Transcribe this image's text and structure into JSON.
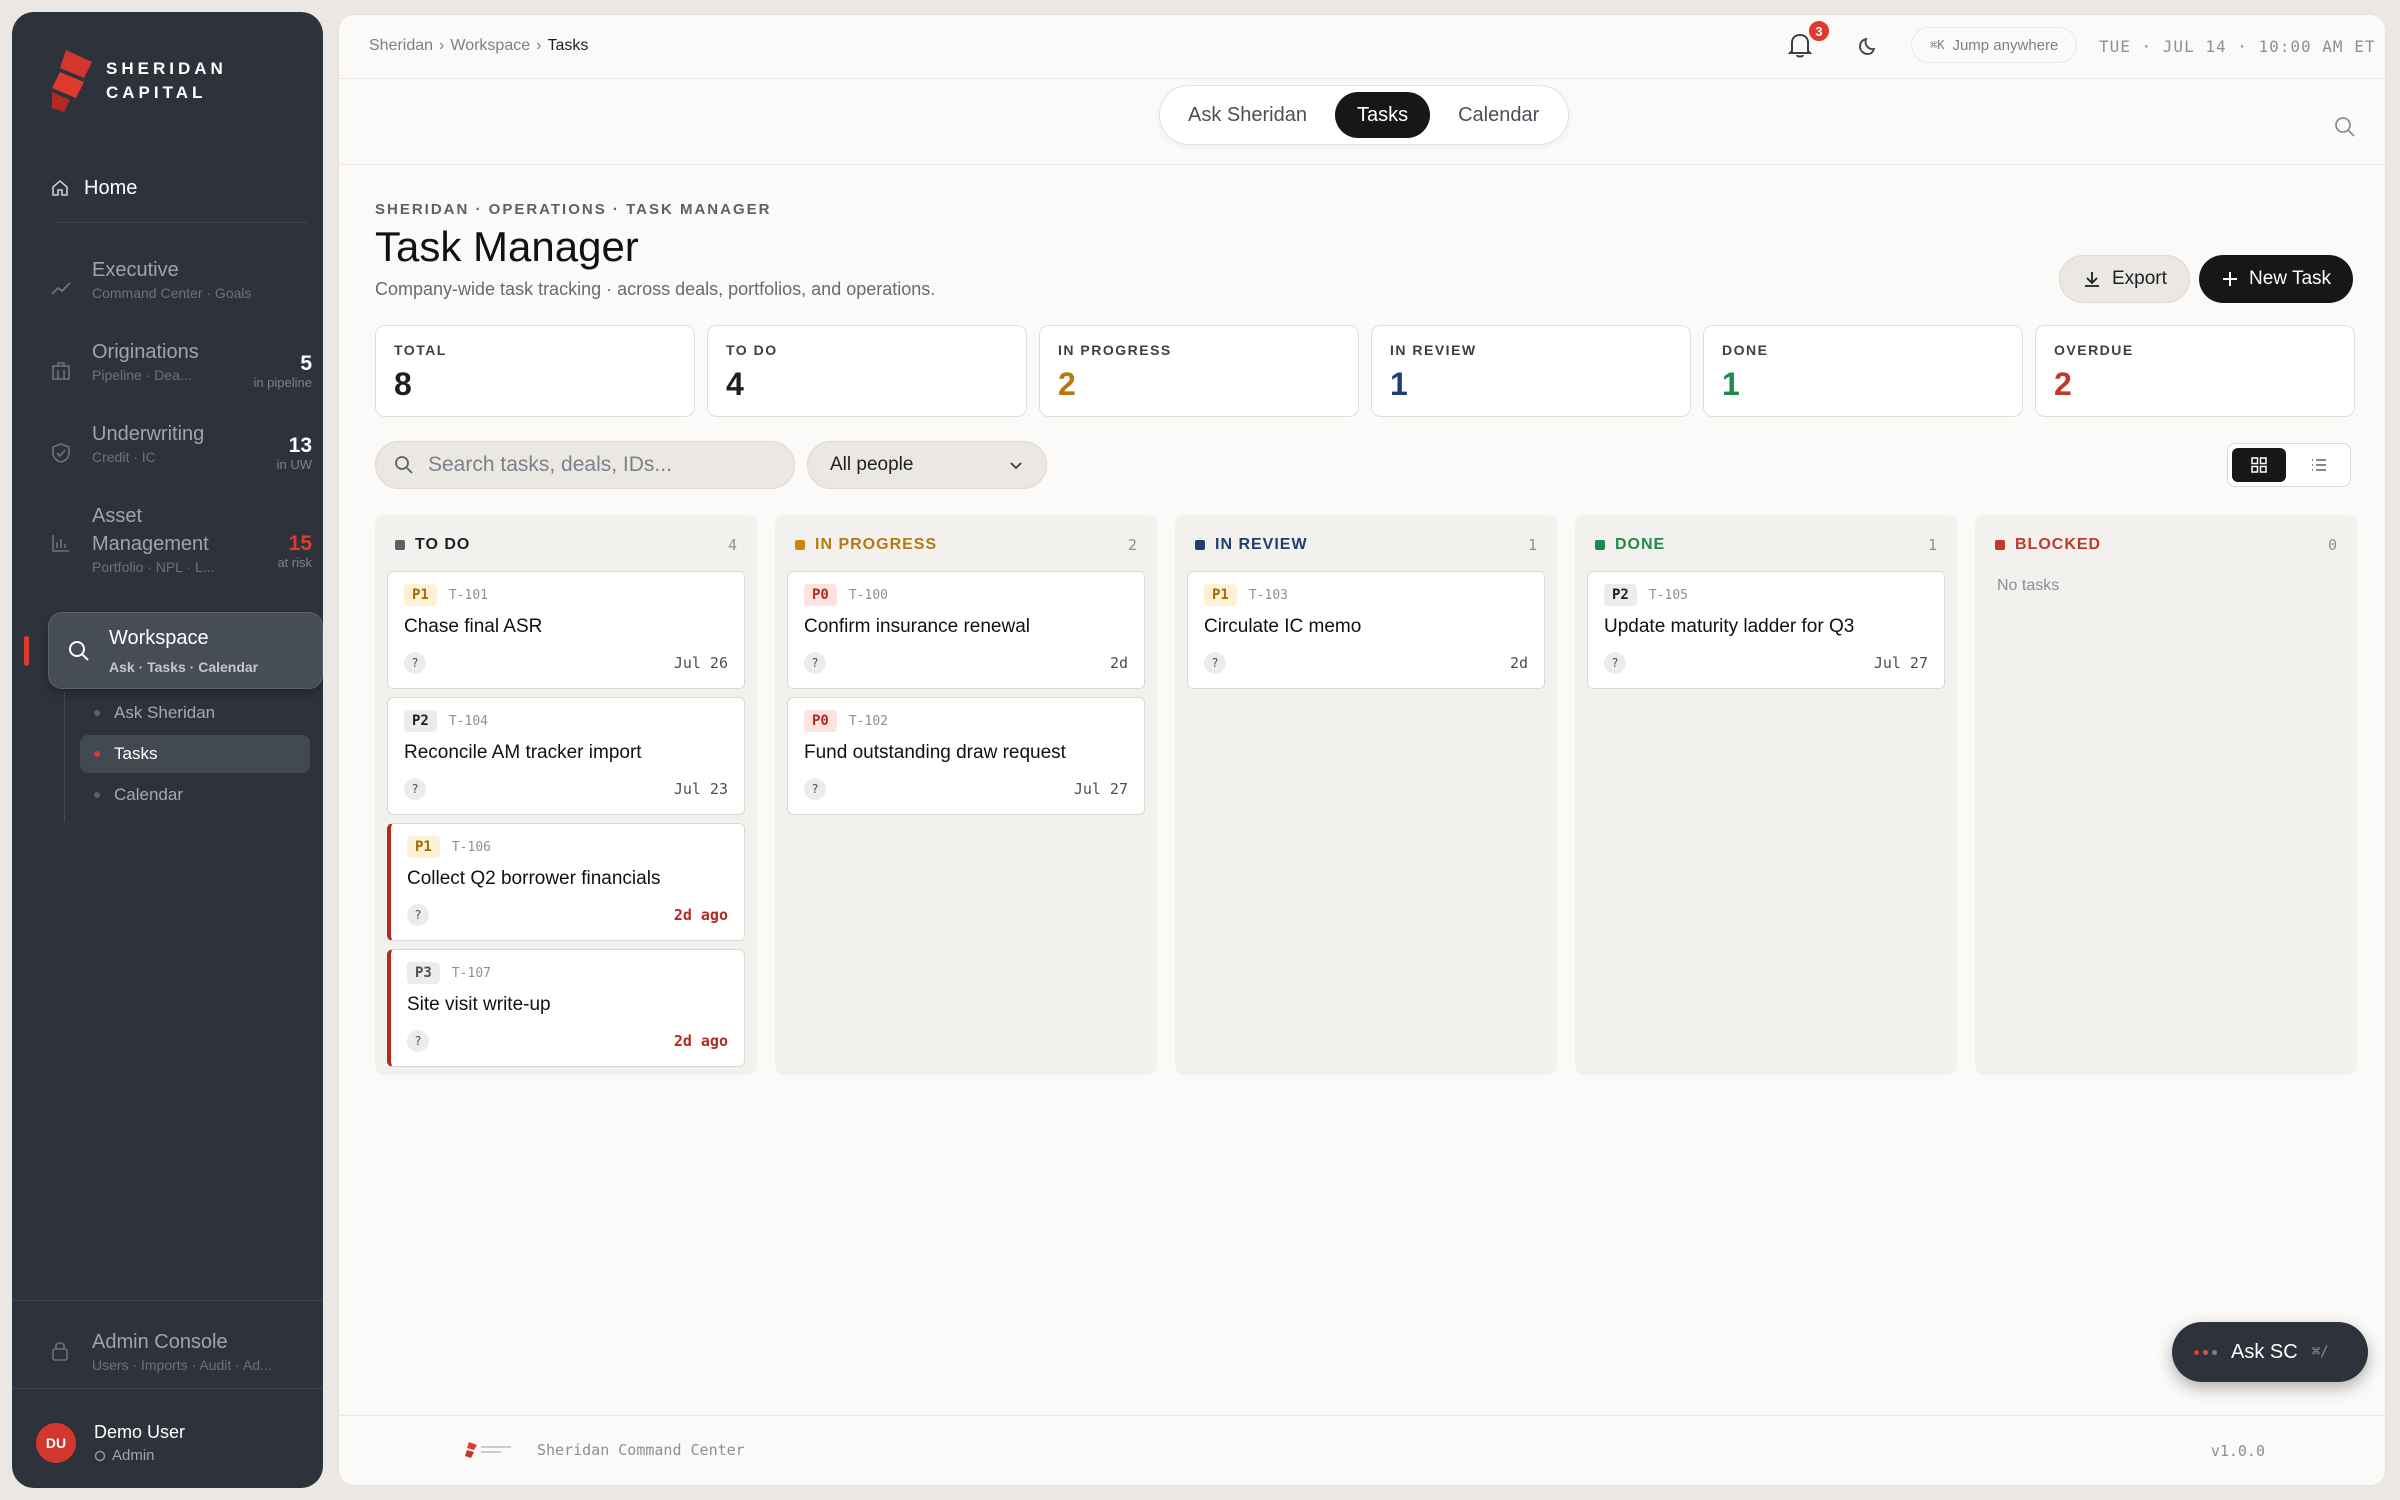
{
  "brand": {
    "line1": "SHERIDAN",
    "line2": "CAPITAL"
  },
  "sidebar": {
    "home": "Home",
    "items": [
      {
        "label": "Executive",
        "sub": "Command Center · Goals",
        "count": "",
        "count_label": ""
      },
      {
        "label": "Originations",
        "sub": "Pipeline · Dea...",
        "count": "5",
        "count_label": "in pipeline"
      },
      {
        "label": "Underwriting",
        "sub": "Credit · IC",
        "count": "13",
        "count_label": "in UW"
      },
      {
        "label": "Asset Management",
        "sub": "Portfolio · NPL · L...",
        "count": "15",
        "count_label": "at risk"
      }
    ],
    "workspace": {
      "label": "Workspace",
      "sub": "Ask · Tasks · Calendar"
    },
    "workspace_items": [
      "Ask Sheridan",
      "Tasks",
      "Calendar"
    ],
    "admin": {
      "label": "Admin Console",
      "sub": "Users · Imports · Audit · Ad..."
    },
    "user": {
      "initials": "DU",
      "name": "Demo User",
      "role": "Admin"
    }
  },
  "topbar": {
    "breadcrumb": [
      "Sheridan",
      "Workspace",
      "Tasks"
    ],
    "notifications": "3",
    "jump_kbd": "⌘K",
    "jump_label": "Jump anywhere",
    "datetime": "TUE · JUL 14 · 10:00 AM ET"
  },
  "tabs": [
    "Ask Sheridan",
    "Tasks",
    "Calendar"
  ],
  "page": {
    "eyebrow": "SHERIDAN · OPERATIONS · TASK MANAGER",
    "title": "Task Manager",
    "subtitle": "Company-wide task tracking · across deals, portfolios, and operations.",
    "export": "Export",
    "new_task": "New Task"
  },
  "stats": [
    {
      "label": "TOTAL",
      "value": "8",
      "color": "#1c1f24"
    },
    {
      "label": "TO DO",
      "value": "4",
      "color": "#1c1f24"
    },
    {
      "label": "IN PROGRESS",
      "value": "2",
      "color": "#b7790f"
    },
    {
      "label": "IN REVIEW",
      "value": "1",
      "color": "#1f3f6e"
    },
    {
      "label": "DONE",
      "value": "1",
      "color": "#1f8a4c"
    },
    {
      "label": "OVERDUE",
      "value": "2",
      "color": "#c0392b"
    }
  ],
  "filters": {
    "search_placeholder": "Search tasks, deals, IDs...",
    "people": "All people"
  },
  "columns": [
    {
      "name": "TO DO",
      "count": "4",
      "color": "#5b616a",
      "text_color": "#1c1f24",
      "cards": [
        {
          "priority": "P1",
          "id": "T-101",
          "title": "Chase final ASR",
          "assignee": "?",
          "due": "Jul 26",
          "overdue": false
        },
        {
          "priority": "P2",
          "id": "T-104",
          "title": "Reconcile AM tracker import",
          "assignee": "?",
          "due": "Jul 23",
          "overdue": false
        },
        {
          "priority": "P1",
          "id": "T-106",
          "title": "Collect Q2 borrower financials",
          "assignee": "?",
          "due": "2d ago",
          "overdue": true
        },
        {
          "priority": "P3",
          "id": "T-107",
          "title": "Site visit write-up",
          "assignee": "?",
          "due": "2d ago",
          "overdue": true
        }
      ]
    },
    {
      "name": "IN PROGRESS",
      "count": "2",
      "color": "#c98a12",
      "text_color": "#b7790f",
      "cards": [
        {
          "priority": "P0",
          "id": "T-100",
          "title": "Confirm insurance renewal",
          "assignee": "?",
          "due": "2d",
          "overdue": false
        },
        {
          "priority": "P0",
          "id": "T-102",
          "title": "Fund outstanding draw request",
          "assignee": "?",
          "due": "Jul 27",
          "overdue": false
        }
      ]
    },
    {
      "name": "IN REVIEW",
      "count": "1",
      "color": "#1f3f6e",
      "text_color": "#1f3f6e",
      "cards": [
        {
          "priority": "P1",
          "id": "T-103",
          "title": "Circulate IC memo",
          "assignee": "?",
          "due": "2d",
          "overdue": false
        }
      ]
    },
    {
      "name": "DONE",
      "count": "1",
      "color": "#1f8a4c",
      "text_color": "#1f8a4c",
      "cards": [
        {
          "priority": "P2",
          "id": "T-105",
          "title": "Update maturity ladder for Q3",
          "assignee": "?",
          "due": "Jul 27",
          "overdue": false
        }
      ]
    },
    {
      "name": "BLOCKED",
      "count": "0",
      "color": "#c0392b",
      "text_color": "#c0392b",
      "cards": [],
      "empty": "No tasks"
    }
  ],
  "footer": {
    "text": "Sheridan Command Center",
    "version": "v1.0.0"
  },
  "ask": {
    "label": "Ask SC",
    "kbd": "⌘/"
  }
}
